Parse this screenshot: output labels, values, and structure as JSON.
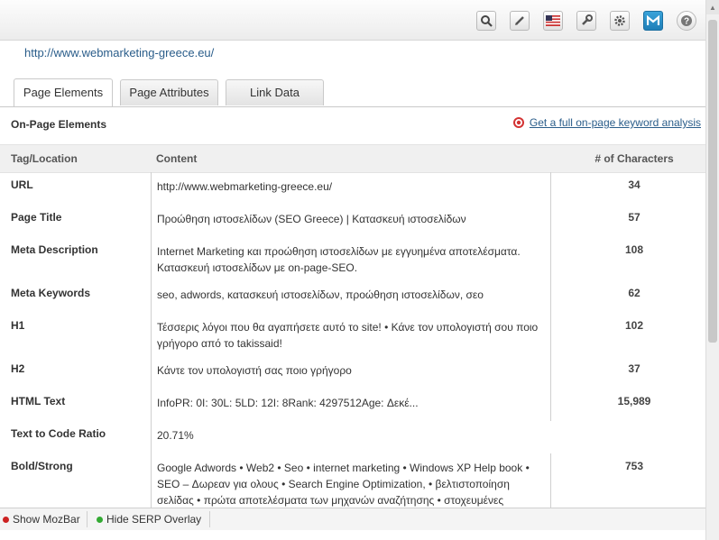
{
  "url": "http://www.webmarketing-greece.eu/",
  "tabs": [
    {
      "label": "Page Elements",
      "active": true
    },
    {
      "label": "Page Attributes",
      "active": false
    },
    {
      "label": "Link Data",
      "active": false
    }
  ],
  "section": {
    "title": "On-Page Elements",
    "link": "Get a full on-page keyword analysis"
  },
  "table": {
    "headers": {
      "tag": "Tag/Location",
      "content": "Content",
      "chars": "# of Characters"
    },
    "rows": [
      {
        "tag": "URL",
        "content": "http://www.webmarketing-greece.eu/",
        "chars": "34"
      },
      {
        "tag": "Page Title",
        "content": "Προώθηση ιστοσελίδων (SEO Greece) | Κατασκευή ιστοσελίδων",
        "chars": "57"
      },
      {
        "tag": "Meta Description",
        "content": "Internet Marketing και προώθηση ιστοσελίδων με εγγυημένα αποτελέσματα. Κατασκευή ιστοσελίδων με on-page-SEO.",
        "chars": "108"
      },
      {
        "tag": "Meta Keywords",
        "content": "seo, adwords, κατασκευή ιστοσελίδων, προώθηση ιστοσελίδων, σεο",
        "chars": "62"
      },
      {
        "tag": "H1",
        "content": "Τέσσερις λόγοι που θα αγαπήσετε αυτό το site! • Κάνε τον υπολογιστή σου ποιο γρήγορο από το takissaid!",
        "chars": "102"
      },
      {
        "tag": "H2",
        "content": "Κάντε τον υπολογιστή σας ποιο γρήγορο",
        "chars": "37"
      },
      {
        "tag": "HTML Text",
        "content": "InfoPR: 0I: 30L: 5LD: 12I: 8Rank: 4297512Age: Δεκέ...",
        "chars": "15,989"
      },
      {
        "tag": "Text to Code Ratio",
        "content": "20.71%",
        "chars": ""
      },
      {
        "tag": "Bold/Strong",
        "content": "Google Adwords • Web2 • Seo • internet marketing • Windows XP Help book • SEO – Δωρεαν για ολους • Search Engine Optimization, • βελτιστοποίηση σελίδας • πρώτα αποτελέσματα των μηχανών αναζήτησης • στοχευμένες",
        "chars": "753"
      }
    ]
  },
  "bottom_bar": {
    "show_mozbar": "Show MozBar",
    "hide_serp": "Hide SERP Overlay"
  },
  "toolbar_icons": [
    "search-icon",
    "pencil-icon",
    "flag-icon",
    "wrench-icon",
    "gear-icon",
    "moz-m-icon",
    "help-icon"
  ],
  "colors": {
    "link": "#2a5d8a",
    "mozbar_dot": "#cc2222",
    "serp_dot": "#33aa33",
    "target_icon": "#d33333"
  }
}
